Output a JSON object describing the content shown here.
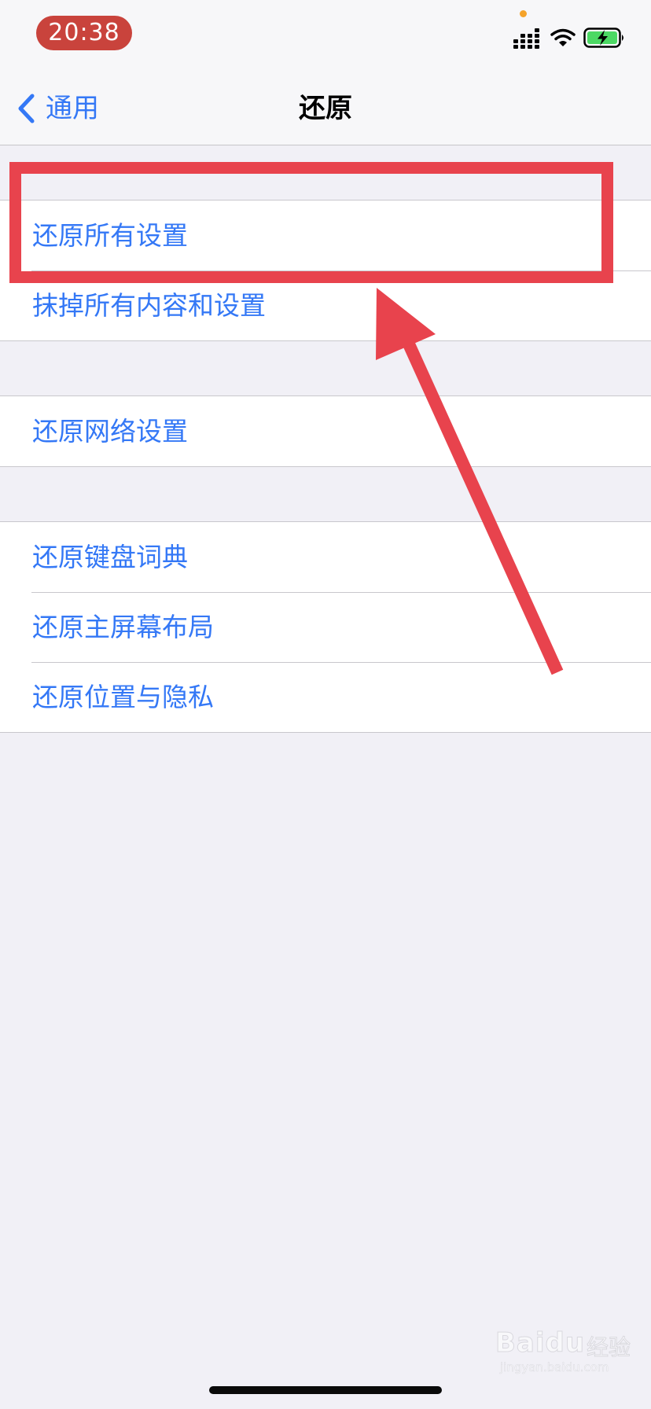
{
  "status_bar": {
    "time": "20:38"
  },
  "nav": {
    "back_label": "通用",
    "title": "还原"
  },
  "groups": [
    {
      "items": [
        {
          "label": "还原所有设置"
        },
        {
          "label": "抹掉所有内容和设置"
        }
      ]
    },
    {
      "items": [
        {
          "label": "还原网络设置"
        }
      ]
    },
    {
      "items": [
        {
          "label": "还原键盘词典"
        },
        {
          "label": "还原主屏幕布局"
        },
        {
          "label": "还原位置与隐私"
        }
      ]
    }
  ],
  "annotation": {
    "color": "#e8434d"
  },
  "watermark": {
    "brand": "Baidu",
    "suffix": "经验",
    "url": "jingyan.baidu.com"
  },
  "colors": {
    "accent": "#3478f6",
    "background": "#f1f0f6",
    "time_pill": "#c9433c",
    "battery": "#4cd964"
  }
}
